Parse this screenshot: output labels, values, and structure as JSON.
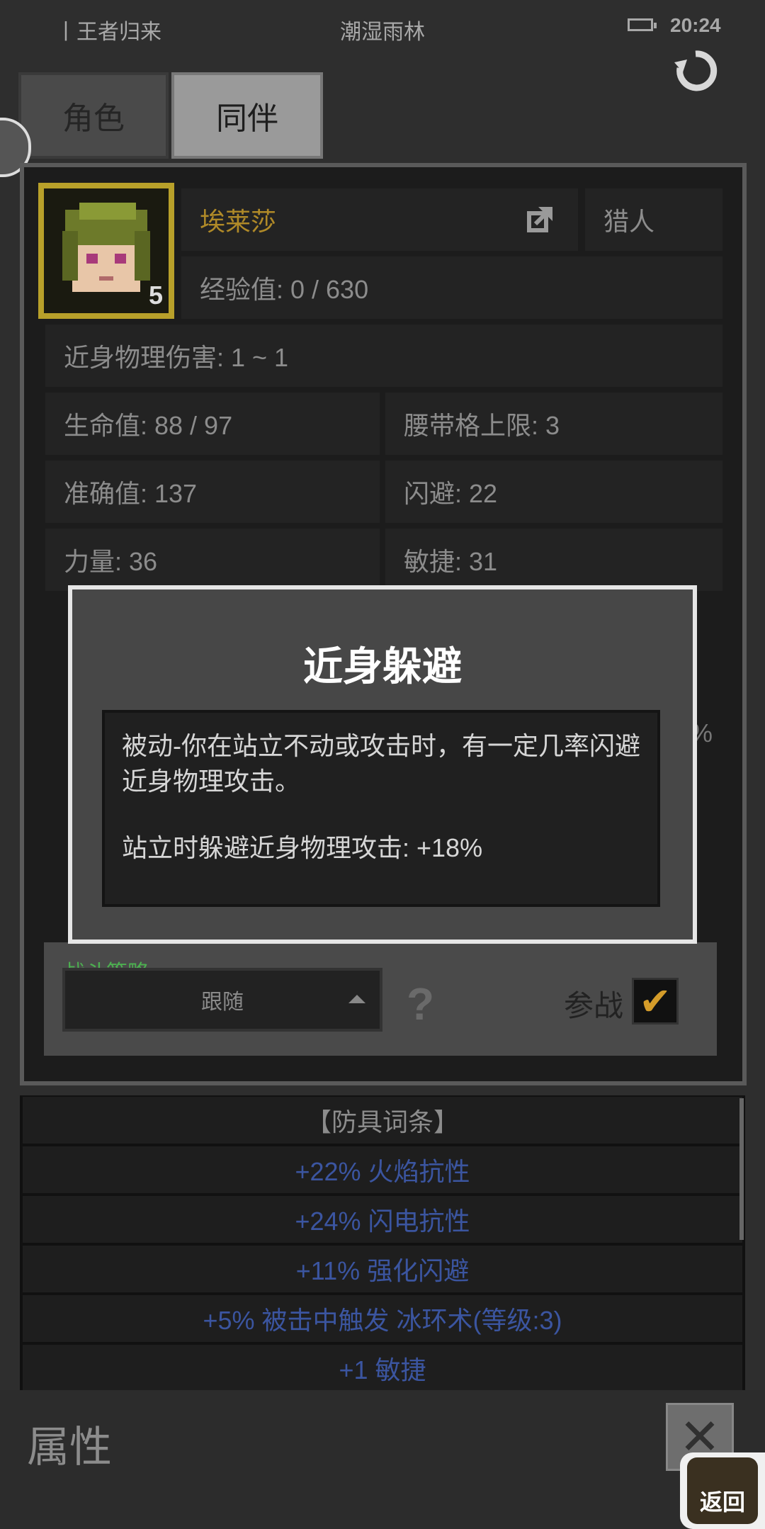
{
  "status_bar": {
    "left_text": "丨王者归来",
    "location": "潮湿雨林",
    "time": "20:24"
  },
  "tabs": [
    {
      "label": "角色"
    },
    {
      "label": "同伴"
    }
  ],
  "character": {
    "name": "埃莱莎",
    "class": "猎人",
    "level": "5",
    "exp": "经验值: 0 / 630"
  },
  "stats": {
    "melee_damage": "近身物理伤害: 1 ~ 1",
    "hp": "生命值: 88 / 97",
    "belt_limit": "腰带格上限: 3",
    "accuracy": "准确值: 137",
    "dodge": "闪避: 22",
    "strength": "力量: 36",
    "agility": "敏捷: 31",
    "hidden_percent": "%"
  },
  "dialog": {
    "title": "近身躲避",
    "description": "被动-你在站立不动或攻击时，有一定几率闪避近身物理攻击。",
    "effect": "站立时躲避近身物理攻击: +18%"
  },
  "strategy": {
    "label": "战斗策略",
    "selected": "跟随",
    "help_icon": "?",
    "join_label": "参战",
    "join_checked": true
  },
  "affixes": {
    "header": "【防具词条】",
    "items": [
      "+22% 火焰抗性",
      "+24% 闪电抗性",
      "+11% 强化闪避",
      "+5% 被击中触发 冰环术(等级:3)",
      "+1 敏捷"
    ],
    "color": "#3b55a0"
  },
  "bottom": {
    "title": "属性",
    "back_label": "返回"
  },
  "colors": {
    "accent_gold": "#b08a28",
    "strategy_green": "#4caf50"
  }
}
